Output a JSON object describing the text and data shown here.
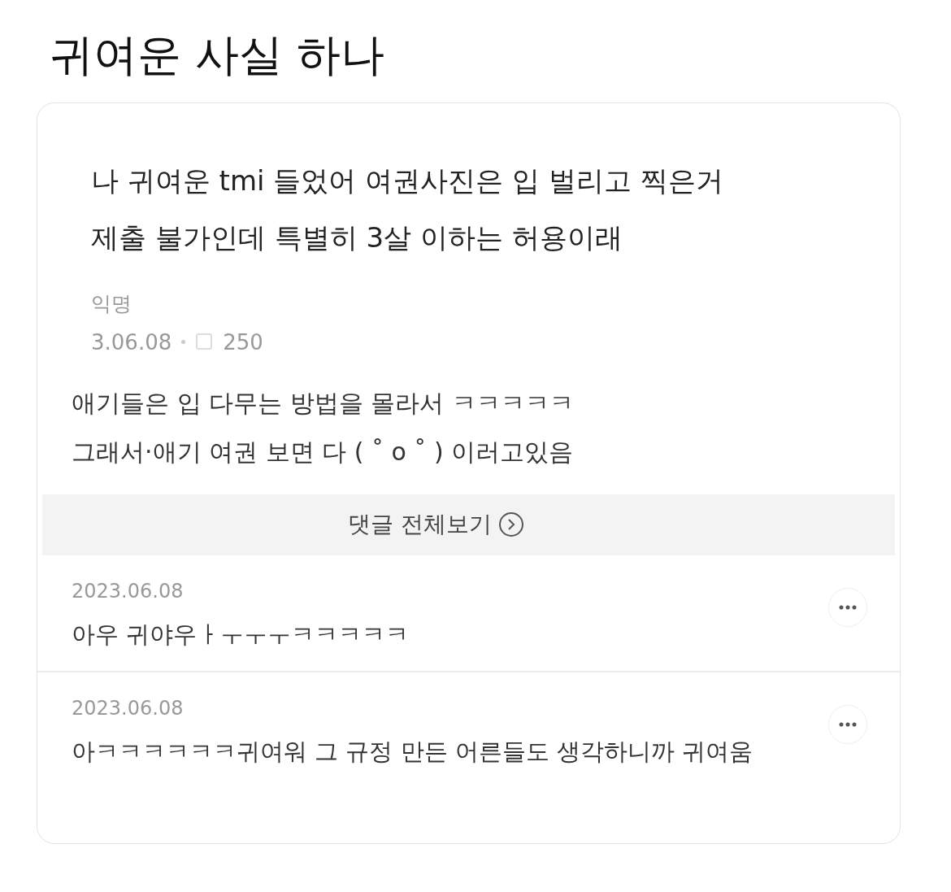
{
  "title": "귀여운 사실 하나",
  "post": {
    "lines": [
      "나 귀여운 tmi 들었어 여권사진은 입 벌리고 찍은거",
      "제출 불가인데 특별히 3살 이하는 허용이래"
    ],
    "author": "익명",
    "date": "3.06.08",
    "comment_count": "250"
  },
  "best_comment": {
    "lines": [
      "애기들은 입 다무는 방법을 몰라서 ㅋㅋㅋㅋㅋ",
      "그래서·애기 여권 보면 다 ( ˚  o ˚  ) 이러고있음"
    ]
  },
  "view_all": "댓글 전체보기",
  "comments": [
    {
      "date": "2023.06.08",
      "text": "아우 귀야우ㅏㅜㅜㅜㅋㅋㅋㅋㅋ"
    },
    {
      "date": "2023.06.08",
      "text": "아ㅋㅋㅋㅋㅋㅋ귀여워 그 규정 만든 어른들도 생각하니까 귀여움"
    }
  ]
}
